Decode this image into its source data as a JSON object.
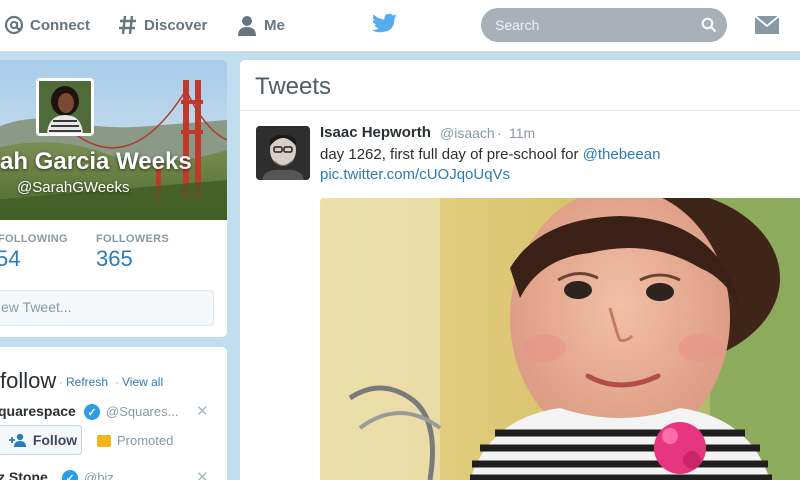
{
  "nav": {
    "connect": "Connect",
    "discover": "Discover",
    "me": "Me",
    "search_placeholder": "Search",
    "icons": [
      "at-icon",
      "hashtag-icon",
      "person-icon",
      "twitter-bird-icon",
      "search-icon",
      "envelope-icon"
    ]
  },
  "profile": {
    "name": "ah Garcia Weeks",
    "handle": "@SarahGWeeks",
    "following_label": "FOLLOWING",
    "following_value": "54",
    "followers_label": "FOLLOWERS",
    "followers_value": "365",
    "compose_placeholder": "ew Tweet..."
  },
  "who_to_follow": {
    "title": "follow",
    "refresh": "Refresh",
    "view_all": "View all",
    "separator": "·",
    "suggestions": [
      {
        "name": "quarespace",
        "handle": "@Squares...",
        "follow_label": "Follow",
        "promoted_label": "Promoted"
      },
      {
        "name": "z Stone",
        "handle": "@biz"
      }
    ]
  },
  "tweets": {
    "header": "Tweets",
    "items": [
      {
        "author": "Isaac Hepworth",
        "handle": "@isaach",
        "separator": "·",
        "time": "11m",
        "text": "day 1262, first full day of pre-school for ",
        "mention": "@thebeean",
        "link": "pic.twitter.com/cUOJqoUqVs"
      }
    ]
  },
  "colors": {
    "background": "#c0deed",
    "link": "#2b7bb9",
    "muted": "#8899a6",
    "brand": "#55acee",
    "promoted": "#f6b31c",
    "verified": "#2b9de6"
  }
}
